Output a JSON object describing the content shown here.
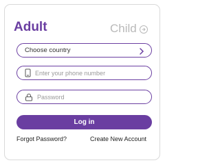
{
  "tabs": {
    "adult_label": "Adult",
    "child_label": "Child"
  },
  "form": {
    "country_value": "Choose country",
    "phone_placeholder": "Enter your phone number",
    "password_placeholder": "Password",
    "login_label": "Log in"
  },
  "links": {
    "forgot_password": "Forgot Password?",
    "create_account": "Create New Account"
  },
  "icons": {
    "child_tab": "arrow-right-circle-icon",
    "country": "chevron-right-icon",
    "phone": "phone-icon",
    "password": "lock-icon"
  },
  "colors": {
    "accent": "#6a3ea1",
    "inactive_tab": "#b9b9b9"
  }
}
